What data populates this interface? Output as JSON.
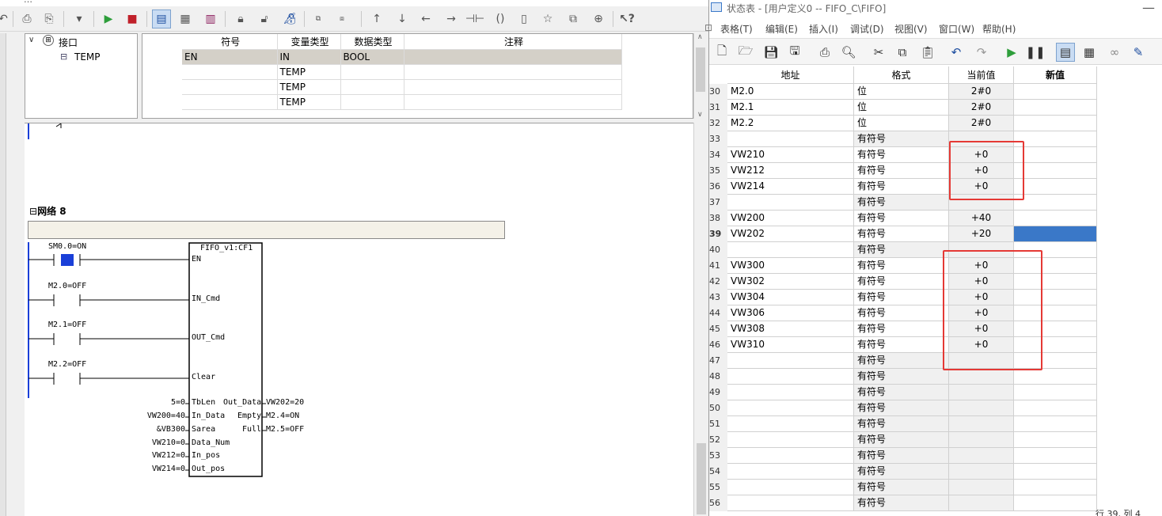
{
  "left": {
    "title_fragment": "…",
    "tree": {
      "root": "接口",
      "child": "TEMP"
    },
    "iface": {
      "headers": [
        "符号",
        "变量类型",
        "数据类型",
        "注释"
      ],
      "rows": [
        {
          "symbol": "EN",
          "vartype": "IN",
          "datatype": "BOOL",
          "comment": ""
        },
        {
          "symbol": "",
          "vartype": "TEMP",
          "datatype": "",
          "comment": ""
        },
        {
          "symbol": "",
          "vartype": "TEMP",
          "datatype": "",
          "comment": ""
        },
        {
          "symbol": "",
          "vartype": "TEMP",
          "datatype": "",
          "comment": ""
        }
      ]
    },
    "network": {
      "title": "网络 8",
      "block_name": "FIFO_v1:CF1",
      "contacts": [
        {
          "label": "SM0.0=ON",
          "pin": "EN"
        },
        {
          "label": "M2.0=OFF",
          "pin": "IN_Cmd"
        },
        {
          "label": "M2.1=OFF",
          "pin": "OUT_Cmd"
        },
        {
          "label": "M2.2=OFF",
          "pin": "Clear"
        }
      ],
      "inputs": [
        {
          "value": "5=0",
          "pin": "TbLen"
        },
        {
          "value": "VW200=40",
          "pin": "In_Data"
        },
        {
          "value": "&VB300",
          "pin": "Sarea"
        },
        {
          "value": "VW210=0",
          "pin": "Data_Num"
        },
        {
          "value": "VW212=0",
          "pin": "In_pos"
        },
        {
          "value": "VW214=0",
          "pin": "Out_pos"
        }
      ],
      "outputs": [
        {
          "pin": "Out_Data",
          "value": "VW202=20"
        },
        {
          "pin": "Empty",
          "value": "M2.4=ON"
        },
        {
          "pin": "Full",
          "value": "M2.5=OFF"
        }
      ]
    }
  },
  "right": {
    "title": "状态表 - [用户定义0 -- FIFO_C\\FIFO]",
    "menu": [
      "表格(T)",
      "编辑(E)",
      "插入(I)",
      "调试(D)",
      "视图(V)",
      "窗口(W)",
      "帮助(H)"
    ],
    "headers": {
      "address": "地址",
      "format": "格式",
      "current": "当前值",
      "new": "新值"
    },
    "rows": [
      {
        "n": "30",
        "addr": "M2.0",
        "fmt": "位",
        "cur": "2#0"
      },
      {
        "n": "31",
        "addr": "M2.1",
        "fmt": "位",
        "cur": "2#0"
      },
      {
        "n": "32",
        "addr": "M2.2",
        "fmt": "位",
        "cur": "2#0"
      },
      {
        "n": "33",
        "addr": "",
        "fmt": "有符号",
        "cur": ""
      },
      {
        "n": "34",
        "addr": "VW210",
        "fmt": "有符号",
        "cur": "+0"
      },
      {
        "n": "35",
        "addr": "VW212",
        "fmt": "有符号",
        "cur": "+0"
      },
      {
        "n": "36",
        "addr": "VW214",
        "fmt": "有符号",
        "cur": "+0"
      },
      {
        "n": "37",
        "addr": "",
        "fmt": "有符号",
        "cur": ""
      },
      {
        "n": "38",
        "addr": "VW200",
        "fmt": "有符号",
        "cur": "+40"
      },
      {
        "n": "39",
        "addr": "VW202",
        "fmt": "有符号",
        "cur": "+20"
      },
      {
        "n": "40",
        "addr": "",
        "fmt": "有符号",
        "cur": ""
      },
      {
        "n": "41",
        "addr": "VW300",
        "fmt": "有符号",
        "cur": "+0"
      },
      {
        "n": "42",
        "addr": "VW302",
        "fmt": "有符号",
        "cur": "+0"
      },
      {
        "n": "43",
        "addr": "VW304",
        "fmt": "有符号",
        "cur": "+0"
      },
      {
        "n": "44",
        "addr": "VW306",
        "fmt": "有符号",
        "cur": "+0"
      },
      {
        "n": "45",
        "addr": "VW308",
        "fmt": "有符号",
        "cur": "+0"
      },
      {
        "n": "46",
        "addr": "VW310",
        "fmt": "有符号",
        "cur": "+0"
      },
      {
        "n": "47",
        "addr": "",
        "fmt": "有符号",
        "cur": ""
      },
      {
        "n": "48",
        "addr": "",
        "fmt": "有符号",
        "cur": ""
      },
      {
        "n": "49",
        "addr": "",
        "fmt": "有符号",
        "cur": ""
      },
      {
        "n": "50",
        "addr": "",
        "fmt": "有符号",
        "cur": ""
      },
      {
        "n": "51",
        "addr": "",
        "fmt": "有符号",
        "cur": ""
      },
      {
        "n": "52",
        "addr": "",
        "fmt": "有符号",
        "cur": ""
      },
      {
        "n": "53",
        "addr": "",
        "fmt": "有符号",
        "cur": ""
      },
      {
        "n": "54",
        "addr": "",
        "fmt": "有符号",
        "cur": ""
      },
      {
        "n": "55",
        "addr": "",
        "fmt": "有符号",
        "cur": ""
      },
      {
        "n": "56",
        "addr": "",
        "fmt": "有符号",
        "cur": ""
      }
    ],
    "status": "行 39, 列 4"
  },
  "colors": {
    "accent_blue": "#3a78c8",
    "red_box": "#e53935",
    "selection": "#c9dcf3",
    "contact_on": "#1a3fd8"
  }
}
